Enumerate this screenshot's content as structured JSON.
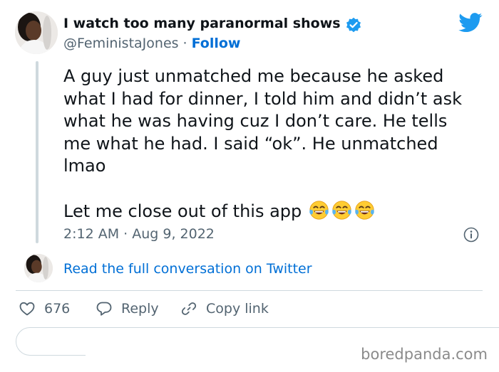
{
  "author": {
    "display_name": "I watch too many paranormal shows",
    "handle": "@FeministaJones",
    "separator": "·",
    "follow_label": "Follow"
  },
  "tweet": {
    "text_paragraph_1": "A guy just unmatched me because he asked what I had for dinner, I told him and didn’t ask what he was having cuz I don’t care. He tells me what he had.  I said “ok”. He unmatched lmao",
    "text_paragraph_2": "Let me close out of this app",
    "emojis": [
      "face-with-tears-of-joy",
      "face-with-tears-of-joy",
      "face-with-tears-of-joy"
    ],
    "timestamp": "2:12 AM · Aug 9, 2022"
  },
  "conversation_link": "Read the full conversation on Twitter",
  "actions": {
    "like_count": "676",
    "reply_label": "Reply",
    "copy_link_label": "Copy link"
  },
  "watermark": "boredpanda.com",
  "colors": {
    "twitter_blue": "#1d9bf0",
    "link_blue": "#006fd6",
    "secondary_text": "#536471",
    "primary_text": "#0f1419",
    "border": "#cfd9de"
  }
}
